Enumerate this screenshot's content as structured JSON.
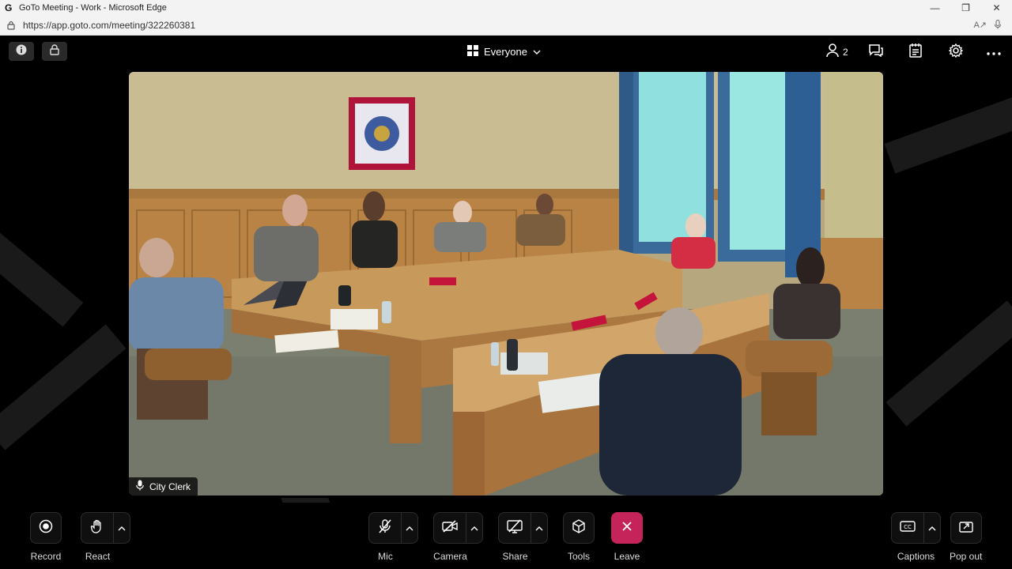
{
  "browser": {
    "logo_letter": "G",
    "window_title": "GoTo Meeting - Work - Microsoft Edge",
    "url": "https://app.goto.com/meeting/322260381"
  },
  "topbar": {
    "view_label": "Everyone",
    "participant_count": "2"
  },
  "video": {
    "speaker_name": "City Clerk",
    "nameplate_text": ""
  },
  "toolbar": {
    "record_label": "Record",
    "react_label": "React",
    "mic_label": "Mic",
    "camera_label": "Camera",
    "share_label": "Share",
    "tools_label": "Tools",
    "leave_label": "Leave",
    "captions_label": "Captions",
    "popout_label": "Pop out"
  },
  "colors": {
    "leave": "#c4245a",
    "background": "#000000"
  },
  "icons": [
    "info-icon",
    "lock-icon",
    "grid-view-icon",
    "chevron-down-icon",
    "person-icon",
    "chat-icon",
    "notes-icon",
    "gear-icon",
    "more-icon",
    "record-icon",
    "hand-icon",
    "mic-off-icon",
    "camera-off-icon",
    "share-off-icon",
    "cube-icon",
    "close-icon",
    "cc-icon",
    "popout-icon"
  ]
}
